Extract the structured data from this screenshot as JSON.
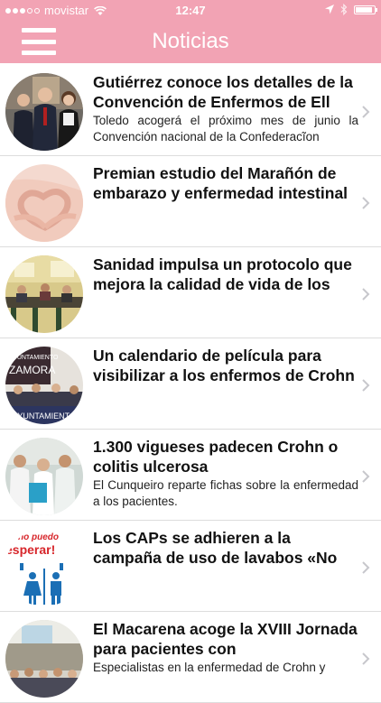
{
  "status_bar": {
    "carrier": "movistar",
    "time": "12:47",
    "battery_level": 0.9
  },
  "nav": {
    "title": "Noticias",
    "menu_icon": "hamburger-menu-icon"
  },
  "news": [
    {
      "title": "Gutiérrez conoce los detalles de la Convención de Enfermos de Ell",
      "summary": "Toledo acogerá el próximo mes de junio la Convención nacional de la Confederacĩon",
      "image": "people-group-photo"
    },
    {
      "title": "Premian estudio del Marañón de embarazo y enfermedad intestinal",
      "summary": "",
      "image": "heart-hands-on-belly"
    },
    {
      "title": "Sanidad impulsa un protocolo que mejora la calidad de vida de los",
      "summary": "",
      "image": "meeting-room"
    },
    {
      "title": "Un calendario de película para visibilizar a los enfermos de Crohn",
      "summary": "",
      "image": "ayuntamiento-zamora-event"
    },
    {
      "title": "1.300 vigueses padecen Crohn o colitis ulcerosa",
      "summary": "El Cunqueiro reparte fichas sobre la enfermedad a los pacientes.",
      "image": "hospital-staff-group"
    },
    {
      "title": "Los CAPs se adhieren a la campaña de uso de lavabos «No",
      "summary": "",
      "image": "no-puedo-esperar-toilet-sign"
    },
    {
      "title": "El Macarena acoge la XVIII Jornada para pacientes con",
      "summary": "Especialistas en la enfermedad de Crohn y",
      "image": "conference-audience"
    }
  ],
  "thumb_texts": {
    "ayuntamiento": "AYUNTAMIENTO",
    "zamora": "ZAMORA",
    "no_puedo": "no puedo",
    "esperar": "esperar!"
  },
  "colors": {
    "bar": "#f2a3b4",
    "title_text": "#111111",
    "separator": "#dddddd",
    "chevron": "#c7c7cc"
  }
}
